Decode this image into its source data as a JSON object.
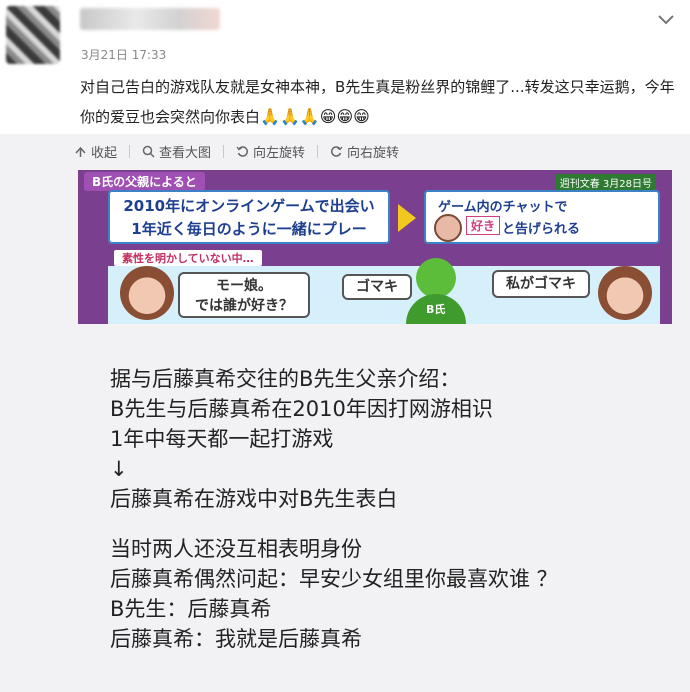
{
  "post": {
    "timestamp": "3月21日 17:33",
    "text": "对自己告白的游戏队友就是女神本神，B先生真是粉丝界的锦鲤了...转发这只幸运鹅，今年你的爱豆也会突然向你表白",
    "emoji": [
      "🙏",
      "🙏",
      "🙏",
      "😁",
      "😁",
      "😁"
    ]
  },
  "toolbar": {
    "collapse": "收起",
    "view_large": "查看大图",
    "rotate_left": "向左旋转",
    "rotate_right": "向右旋转"
  },
  "tv_screen": {
    "header": "B氏の父親によると",
    "logo": "週刊文春 3月28日号",
    "box1_line1": "2010年にオンラインゲームで出会い",
    "box1_line2": "1年近く毎日のように一緒にプレー",
    "box2_line1": "ゲーム内のチャットで",
    "box2_suki": "好き",
    "box2_line2": "と告げられる",
    "secret": "素性を明かしていない中…",
    "bubble1_line1": "モー娘。",
    "bubble1_line2": "では誰が好き？",
    "bubble2": "ゴマキ",
    "b_label": "B氏",
    "bubble3": "私がゴマキ"
  },
  "caption": {
    "lines": [
      "据与后藤真希交往的B先生父亲介绍：",
      "B先生与后藤真希在2010年因打网游相识",
      "1年中每天都一起打游戏",
      "↓",
      "后藤真希在游戏中对B先生表白",
      "",
      "当时两人还没互相表明身份",
      "后藤真希偶然问起：早安少女组里你最喜欢谁 ？",
      "B先生：后藤真希",
      "后藤真希：我就是后藤真希"
    ]
  }
}
